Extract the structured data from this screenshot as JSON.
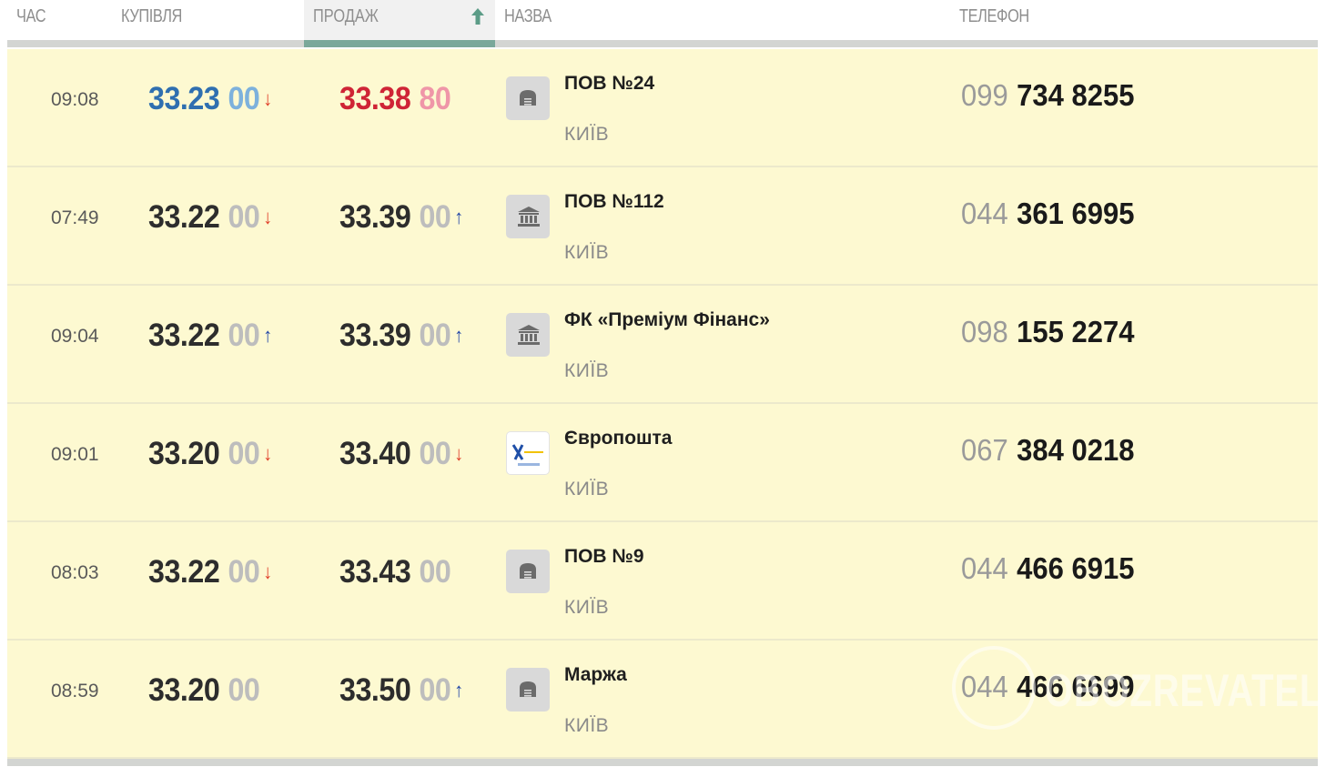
{
  "header": {
    "time": "ЧАС",
    "buy": "КУПІВЛЯ",
    "sell": "ПРОДАЖ",
    "name": "НАЗВА",
    "phone": "ТЕЛЕФОН",
    "sort_icon": "sort-up-arrow-icon"
  },
  "colors": {
    "row_bg": "#fdf9d1",
    "active_column": "#7aa89a",
    "buy_highlight": "#2f6fb0",
    "sell_highlight": "#cf2436",
    "arrow_down": "#e0402a",
    "arrow_up": "#2448a8"
  },
  "rows": [
    {
      "time": "09:08",
      "buy": "33.23",
      "buy_frac": "00",
      "buy_arrow": "↓",
      "sell": "33.38",
      "sell_frac": "80",
      "sell_arrow": "",
      "logo": "vault-icon",
      "name": "ПОВ №24",
      "city": "КИЇВ",
      "phone_code": "099",
      "phone_num": "734 8255"
    },
    {
      "time": "07:49",
      "buy": "33.22",
      "buy_frac": "00",
      "buy_arrow": "↓",
      "sell": "33.39",
      "sell_frac": "00",
      "sell_arrow": "↑",
      "logo": "bank-icon",
      "name": "ПОВ №112",
      "city": "КИЇВ",
      "phone_code": "044",
      "phone_num": "361 6995"
    },
    {
      "time": "09:04",
      "buy": "33.22",
      "buy_frac": "00",
      "buy_arrow": "↑",
      "sell": "33.39",
      "sell_frac": "00",
      "sell_arrow": "↑",
      "logo": "bank-icon",
      "name": "ФК «Преміум Фінанс»",
      "city": "КИЇВ",
      "phone_code": "098",
      "phone_num": "155 2274"
    },
    {
      "time": "09:01",
      "buy": "33.20",
      "buy_frac": "00",
      "buy_arrow": "↓",
      "sell": "33.40",
      "sell_frac": "00",
      "sell_arrow": "↓",
      "logo": "europoshta-logo",
      "name": "Європошта",
      "city": "КИЇВ",
      "phone_code": "067",
      "phone_num": "384 0218"
    },
    {
      "time": "08:03",
      "buy": "33.22",
      "buy_frac": "00",
      "buy_arrow": "↓",
      "sell": "33.43",
      "sell_frac": "00",
      "sell_arrow": "",
      "logo": "vault-icon",
      "name": "ПОВ №9",
      "city": "КИЇВ",
      "phone_code": "044",
      "phone_num": "466 6915"
    },
    {
      "time": "08:59",
      "buy": "33.20",
      "buy_frac": "00",
      "buy_arrow": "",
      "sell": "33.50",
      "sell_frac": "00",
      "sell_arrow": "↑",
      "logo": "vault-icon",
      "name": "Маржа",
      "city": "КИЇВ",
      "phone_code": "044",
      "phone_num": "466 6699"
    }
  ],
  "watermark": "OBOZREVATEL"
}
